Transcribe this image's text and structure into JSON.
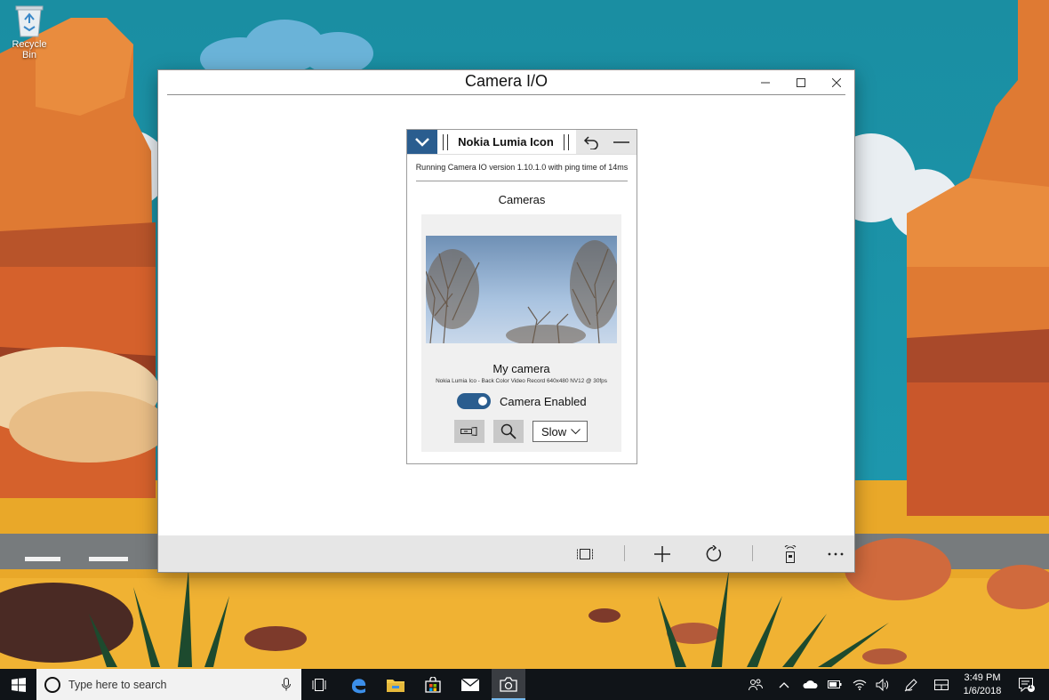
{
  "desktop": {
    "recycle_bin_label": "Recycle Bin"
  },
  "window": {
    "title": "Camera I/O",
    "controls": [
      "minimize-icon",
      "maximize-icon",
      "close-icon"
    ]
  },
  "panel": {
    "device_name": "Nokia Lumia Icon",
    "status": "Running Camera IO version 1.10.1.0 with ping time of 14ms",
    "section_title": "Cameras",
    "camera": {
      "name": "My camera",
      "description": "Nokia Lumia Ico - Back Color Video Record 640x480 NV12 @ 30fps",
      "toggle_label": "Camera Enabled",
      "enabled": true,
      "speed_selected": "Slow"
    }
  },
  "appbar": {
    "icons": [
      "fit-screen-icon",
      "add-icon",
      "refresh-icon",
      "remote-icon",
      "more-icon"
    ]
  },
  "taskbar": {
    "search_placeholder": "Type here to search",
    "time": "3:49 PM",
    "date": "1/6/2018",
    "notification_count": "1"
  },
  "colors": {
    "accent": "#2a5d8f",
    "appbar": "#e6e6e6",
    "taskbar": "#101418"
  }
}
